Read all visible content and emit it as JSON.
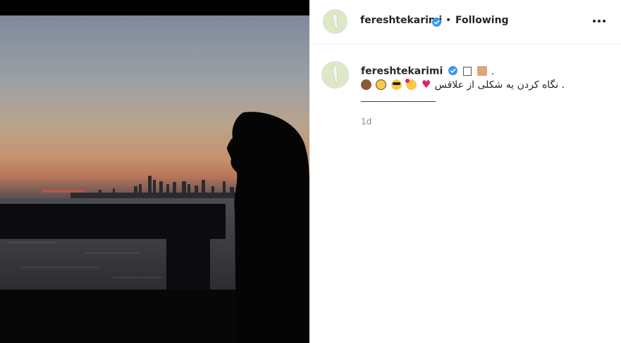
{
  "post": {
    "username": "fereshtekarimi",
    "verified": true,
    "separator": "•",
    "follow_status": "Following",
    "more_icon": "more-horizontal-icon"
  },
  "caption": {
    "username": "fereshtekarimi",
    "period": ".",
    "text": "نگاه کردن یه شکلی از علاقس",
    "end_period": ".",
    "divider": "_____________________",
    "emoji_sequence": [
      "monkey-emoji",
      "nerd-emoji",
      "sunglasses-emoji",
      "heart-eyes-emoji",
      "red-heart-emoji"
    ],
    "heart": "♥",
    "timestamp": "1d"
  },
  "colors": {
    "text": "#262626",
    "muted": "#8e8e8e",
    "verified_blue": "#3897f0",
    "border": "#efefef"
  }
}
